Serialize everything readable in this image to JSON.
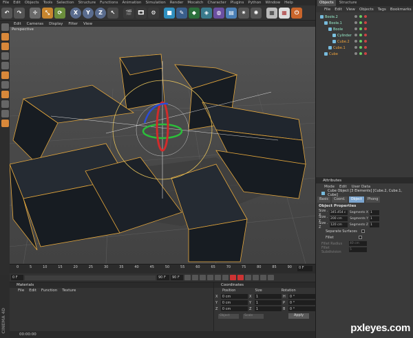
{
  "app_menu": [
    "File",
    "Edit",
    "Objects",
    "Tools",
    "Selection",
    "Structure",
    "Functions",
    "Animation",
    "Simulation",
    "Render",
    "Mocatch",
    "Character",
    "Plugins",
    "Python",
    "Window",
    "Help"
  ],
  "toolbar": {
    "buttons": [
      "undo-icon",
      "redo-icon",
      "move-icon",
      "scale-icon",
      "rotate-icon",
      "x-axis-icon",
      "y-axis-icon",
      "z-axis-icon",
      "world-coord-icon",
      "render-view-icon",
      "render-picture-icon",
      "render-settings-icon",
      "cube-icon",
      "pen-icon",
      "subdivision-icon",
      "array-icon",
      "deformer-icon",
      "floor-icon",
      "camera-icon",
      "light-icon",
      "layout-icon",
      "layout-grid-icon",
      "snap-icon"
    ],
    "axis_labels": [
      "X",
      "Y",
      "Z"
    ]
  },
  "viewport": {
    "menu": [
      "Edit",
      "Cameras",
      "Display",
      "Filter",
      "View"
    ],
    "label": "Perspective"
  },
  "timeline": {
    "ticks": [
      "0",
      "5",
      "10",
      "15",
      "20",
      "25",
      "30",
      "35",
      "40",
      "45",
      "50",
      "55",
      "60",
      "65",
      "70",
      "75",
      "80",
      "85",
      "90"
    ],
    "frame": "0 F",
    "start_field": "0 F",
    "current_field": "90 F",
    "end_field": "90 F"
  },
  "materials": {
    "title": "Materials",
    "menu": [
      "File",
      "Edit",
      "Function",
      "Texture"
    ]
  },
  "coordinates": {
    "title": "Coordinates",
    "headers": [
      "Position",
      "Size",
      "Rotation"
    ],
    "rows": [
      {
        "axis": "X",
        "pos": "0 cm",
        "size": "1",
        "rot_axis": "H",
        "rot": "0 °"
      },
      {
        "axis": "Y",
        "pos": "0 cm",
        "size": "1",
        "rot_axis": "P",
        "rot": "0 °"
      },
      {
        "axis": "Z",
        "pos": "0 cm",
        "size": "1",
        "rot_axis": "B",
        "rot": "0 °"
      }
    ],
    "mode": "Object",
    "scale_mode": "Scale",
    "apply": "Apply"
  },
  "status": "00:00:00",
  "brand": "CINEMA 4D",
  "object_manager": {
    "tabs": [
      "Objects",
      "Structure"
    ],
    "menu": [
      "File",
      "Edit",
      "View",
      "Objects",
      "Tags",
      "Bookmarks"
    ],
    "items": [
      {
        "name": "Boole.2",
        "indent": 0,
        "selected": false
      },
      {
        "name": "Boole.1",
        "indent": 1,
        "selected": false
      },
      {
        "name": "Boole",
        "indent": 2,
        "selected": false
      },
      {
        "name": "Cylinder",
        "indent": 3,
        "selected": false
      },
      {
        "name": "Cube.2",
        "indent": 3,
        "selected": true
      },
      {
        "name": "Cube.1",
        "indent": 2,
        "selected": true
      },
      {
        "name": "Cube",
        "indent": 1,
        "selected": true
      }
    ]
  },
  "attributes": {
    "title": "Attributes",
    "menu": [
      "Mode",
      "Edit",
      "User Data"
    ],
    "subtitle": "Cube Object [3 Elements] [Cube.2, Cube.1, Cube]",
    "tabs": [
      "Basic",
      "Coord.",
      "Object",
      "Phong"
    ],
    "active_tab": "Object",
    "section": "Object Properties",
    "rows": [
      {
        "label": "Size . X",
        "value": "345.454 c",
        "seg_label": "Segments X",
        "seg": "1"
      },
      {
        "label": "Size . Y",
        "value": "200 cm",
        "seg_label": "Segments Y",
        "seg": "1"
      },
      {
        "label": "Size . Z",
        "value": "120 cm",
        "seg_label": "Segments Z",
        "seg": "1"
      }
    ],
    "separate": "Separate Surfaces",
    "fillet": "Fillet",
    "fillet_radius_label": "Fillet Radius",
    "fillet_radius": "40 cm",
    "fillet_sub_label": "Fillet Subdivision",
    "fillet_sub": "5"
  },
  "watermark": "pxleyes.com"
}
